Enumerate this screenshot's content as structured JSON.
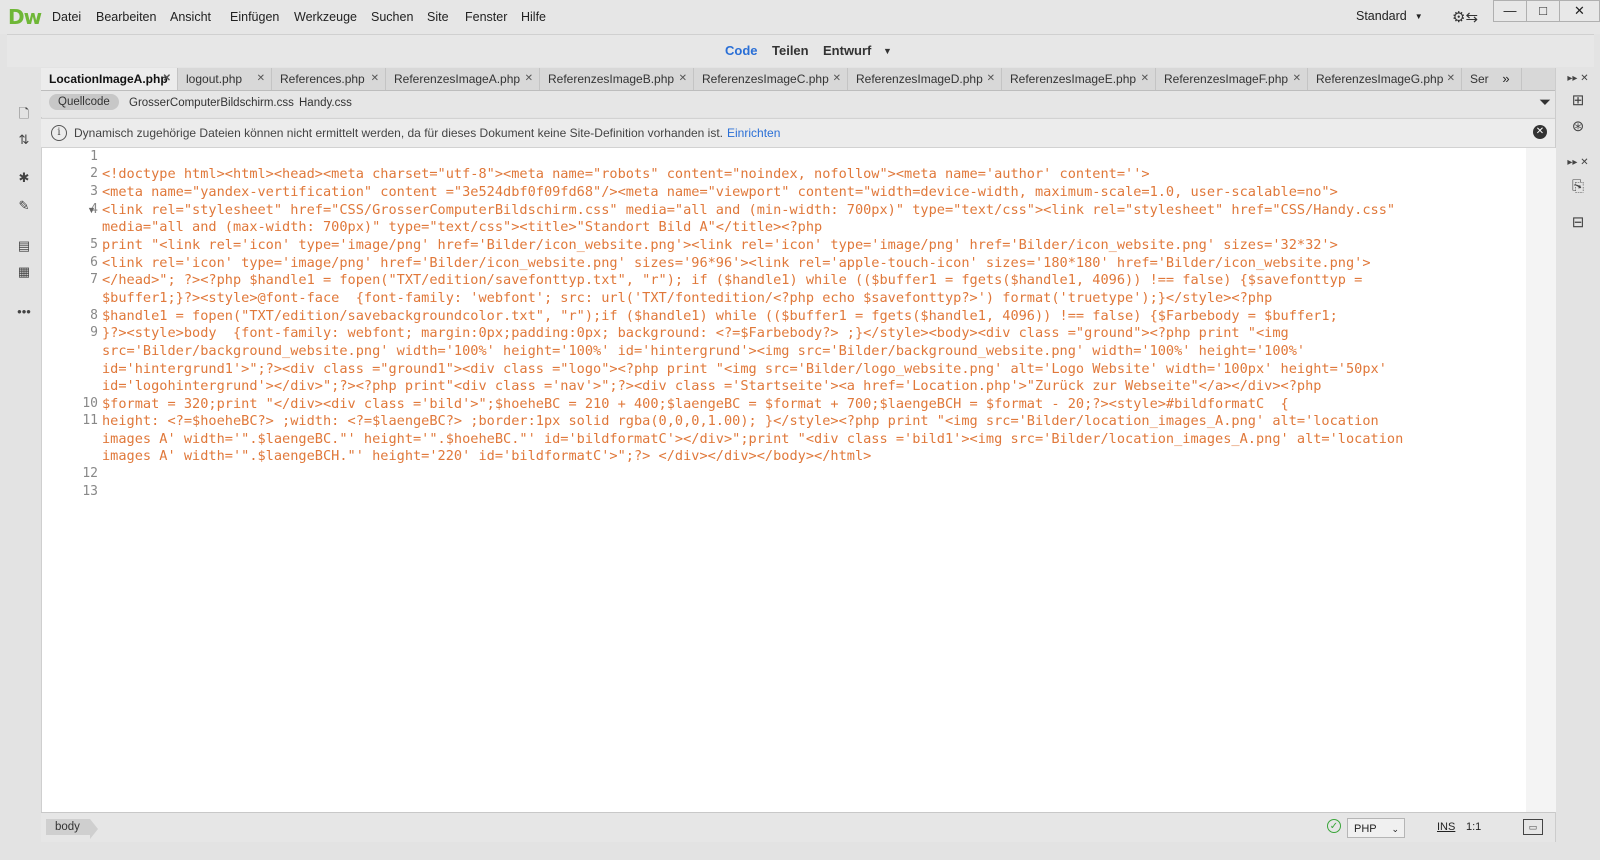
{
  "app": {
    "logo": "Dw",
    "menu": [
      "Datei",
      "Bearbeiten",
      "Ansicht",
      "Einfügen",
      "Werkzeuge",
      "Suchen",
      "Site",
      "Fenster",
      "Hilfe"
    ],
    "workspace": "Standard"
  },
  "view_switcher": {
    "code": "Code",
    "split": "Teilen",
    "design": "Entwurf"
  },
  "tabs": [
    "LocationImageA.php",
    "logout.php",
    "References.php",
    "ReferenzesImageA.php",
    "ReferenzesImageB.php",
    "ReferenzesImageC.php",
    "ReferenzesImageD.php",
    "ReferenzesImageE.php",
    "ReferenzesImageF.php",
    "ReferenzesImageG.php",
    "Ser"
  ],
  "active_tab": "LocationImageA.php",
  "related_files": [
    "Quellcode",
    "GrosserComputerBildschirm.css",
    "Handy.css"
  ],
  "info_bar": {
    "message": "Dynamisch zugehörige Dateien können nicht ermittelt werden, da für dieses Dokument keine Site-Definition vorhanden ist.",
    "link": "Einrichten"
  },
  "line_numbers": [
    "1",
    "2",
    "3",
    "4",
    "5",
    "6",
    "7",
    "8",
    "9",
    "10",
    "11",
    "12",
    "13"
  ],
  "code_lines": [
    "",
    "<!doctype html><html><head><meta charset=\"utf-8\"><meta name=\"robots\" content=\"noindex, nofollow\"><meta name='author' content=''>",
    "<meta name=\"yandex-vertification\" content =\"3e524dbf0f09fd68\"/><meta name=\"viewport\" content=\"width=device-width, maximum-scale=1.0, user-scalable=no\">",
    "<link rel=\"stylesheet\" href=\"CSS/GrosserComputerBildschirm.css\" media=\"all and (min-width: 700px)\" type=\"text/css\"><link rel=\"stylesheet\" href=\"CSS/Handy.css\"",
    "media=\"all and (max-width: 700px)\" type=\"text/css\"><title>\"Standort Bild A\"</title><?php",
    "print \"<link rel='icon' type='image/png' href='Bilder/icon_website.png'><link rel='icon' type='image/png' href='Bilder/icon_website.png' sizes='32*32'>",
    "<link rel='icon' type='image/png' href='Bilder/icon_website.png' sizes='96*96'><link rel='apple-touch-icon' sizes='180*180' href='Bilder/icon_website.png'>",
    "</head>\"; ?><?php $handle1 = fopen(\"TXT/edition/savefonttyp.txt\", \"r\"); if ($handle1) while (($buffer1 = fgets($handle1, 4096)) !== false) {$savefonttyp =",
    "$buffer1;}?><style>@font-face  {font-family: 'webfont'; src: url('TXT/fontedition/<?php echo $savefonttyp?>') format('truetype');}</style><?php",
    "$handle1 = fopen(\"TXT/edition/savebackgroundcolor.txt\", \"r\");if ($handle1) while (($buffer1 = fgets($handle1, 4096)) !== false) {$Farbebody = $buffer1;",
    "}?><style>body  {font-family: webfont; margin:0px;padding:0px; background: <?=$Farbebody?> ;}</style><body><div class =\"ground\"><?php print \"<img",
    "src='Bilder/background_website.png' width='100%' height='100%' id='hintergrund'><img src='Bilder/background_website.png' width='100%' height='100%'",
    "id='hintergrund1'>\";?><div class =\"ground1\"><div class =\"logo\"><?php print \"<img src='Bilder/logo_website.png' alt='Logo Website' width='100px' height='50px'",
    "id='logohintergrund'></div>\";?><?php print\"<div class ='nav'>\";?><div class ='Startseite'><a href='Location.php'>\"Zurück zur Webseite\"</a></div><?php",
    "$format = 320;print \"</div><div class ='bild'>\";$hoeheBC = 210 + 400;$laengeBC = $format + 700;$laengeBCH = $format - 20;?><style>#bildformatC  {",
    "height: <?=$hoeheBC?> ;width: <?=$laengeBC?> ;border:1px solid rgba(0,0,0,1.00); }</style><?php print \"<img src='Bilder/location_images_A.png' alt='location",
    "images A' width='\".$laengeBC.\"' height='\".$hoeheBC.\"' id='bildformatC'></div>\";print \"<div class ='bild1'><img src='Bilder/location_images_A.png' alt='location",
    "images A' width='\".$laengeBCH.\"' height='220' id='bildformatC'>\";?> </div></div></body></html>",
    "",
    ""
  ],
  "status_bar": {
    "tag": "body",
    "language": "PHP",
    "ins": "INS",
    "position": "1:1"
  },
  "colors": {
    "accent": "#2a6fd6",
    "code_tag": "#e0783a",
    "logo": "#6fb737"
  },
  "icons": [
    "gear-icon",
    "minimize-icon",
    "maximize-icon",
    "close-icon",
    "filter-icon",
    "info-icon",
    "checkmark-icon"
  ]
}
